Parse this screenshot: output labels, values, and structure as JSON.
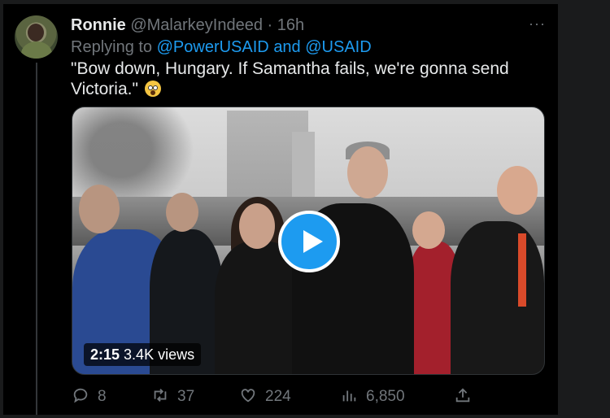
{
  "tweet": {
    "author_name": "Ronnie",
    "handle": "@MalarkeyIndeed",
    "separator": "·",
    "time": "16h",
    "more_label": "···",
    "replying_prefix": "Replying to",
    "mention_1": "@PowerUSAID",
    "and_word": "and",
    "mention_2": "@USAID",
    "text": "\"Bow down, Hungary. If Samantha fails, we're gonna send Victoria.\""
  },
  "media": {
    "duration": "2:15",
    "views_label": "3.4K views"
  },
  "actions": {
    "reply_count": "8",
    "retweet_count": "37",
    "like_count": "224",
    "view_count": "6,850"
  },
  "icons": {
    "reply": "reply-icon",
    "retweet": "retweet-icon",
    "like": "heart-icon",
    "views": "analytics-icon",
    "share": "share-icon"
  },
  "colors": {
    "accent": "#1d9bf0",
    "muted": "#71767b",
    "text": "#e7e9ea",
    "background": "#000000"
  }
}
